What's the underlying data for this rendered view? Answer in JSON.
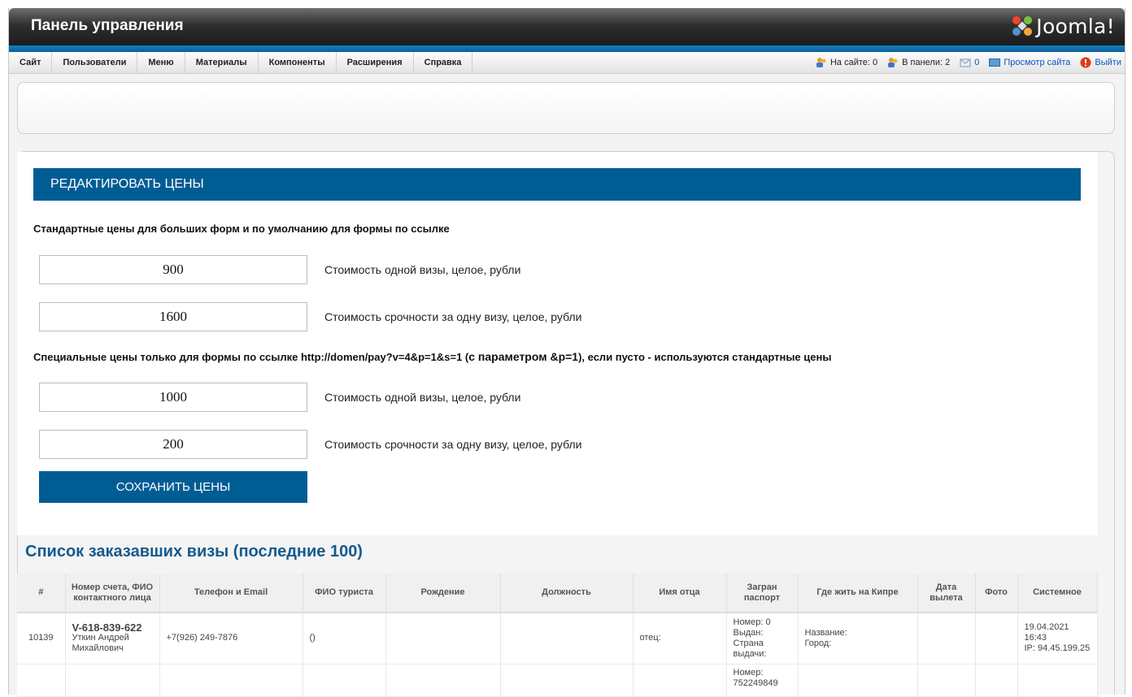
{
  "header": {
    "title": "Панель управления",
    "logo_text": "Joomla!"
  },
  "menu": {
    "items": [
      {
        "id": "site",
        "label": "Сайт"
      },
      {
        "id": "users",
        "label": "Пользователи"
      },
      {
        "id": "menus",
        "label": "Меню"
      },
      {
        "id": "content",
        "label": "Материалы"
      },
      {
        "id": "components",
        "label": "Компоненты"
      },
      {
        "id": "extensions",
        "label": "Расширения"
      },
      {
        "id": "help",
        "label": "Справка"
      }
    ]
  },
  "status": {
    "on_site": "На сайте: 0",
    "in_admin": "В панели: 2",
    "messages": "0",
    "view_site": "Просмотр сайта",
    "logout": "Выйти"
  },
  "prices": {
    "heading": "РЕДАКТИРОВАТЬ ЦЕНЫ",
    "standard_title": "Стандартные цены для больших форм и по умолчанию для формы по ссылке",
    "special_title_pre": "Специальные цены только для формы по ссылке http://domen/pay?v=4&p=1&s=1 (",
    "special_title_param": "с параметром &p=1",
    "special_title_post": "), если пусто - используются стандартные цены",
    "visa_label": "Стоимость одной визы, целое, рубли",
    "urgent_label": "Стоимость срочности за одну визу, целое, рубли",
    "standard_visa": "900",
    "standard_urgent": "1600",
    "special_visa": "1000",
    "special_urgent": "200",
    "save_label": "СОХРАНИТЬ ЦЕНЫ"
  },
  "orders": {
    "title": "Список заказавших визы (последние 100)",
    "columns": {
      "num": "#",
      "account": "Номер счета, ФИО контактного лица",
      "phone": "Телефон и Email",
      "tourist": "ФИО туриста",
      "birth": "Рождение",
      "position": "Должность",
      "father": "Имя отца",
      "passport": "Загран паспорт",
      "cyprus": "Где жить на Кипре",
      "departure": "Дата вылета",
      "photo": "Фото",
      "system": "Системное"
    },
    "rows": [
      {
        "num": "10139",
        "account": "V-618-839-622",
        "contact": "Уткин Андрей Михайлович",
        "phone": "+7(926) 249-7876",
        "tourist": "()",
        "birth": "",
        "position": "",
        "father": "отец:",
        "passport_number": "Номер: 0",
        "passport_issued": "Выдан:",
        "passport_country": "Страна выдачи:",
        "cyprus_name": "Название:",
        "cyprus_city": "Город:",
        "departure": "",
        "photo": "",
        "system_date": "19.04.2021 16:43",
        "system_ip": "IP: 94.45.199.25"
      },
      {
        "passport_number": "Номер: 752249849"
      }
    ]
  }
}
